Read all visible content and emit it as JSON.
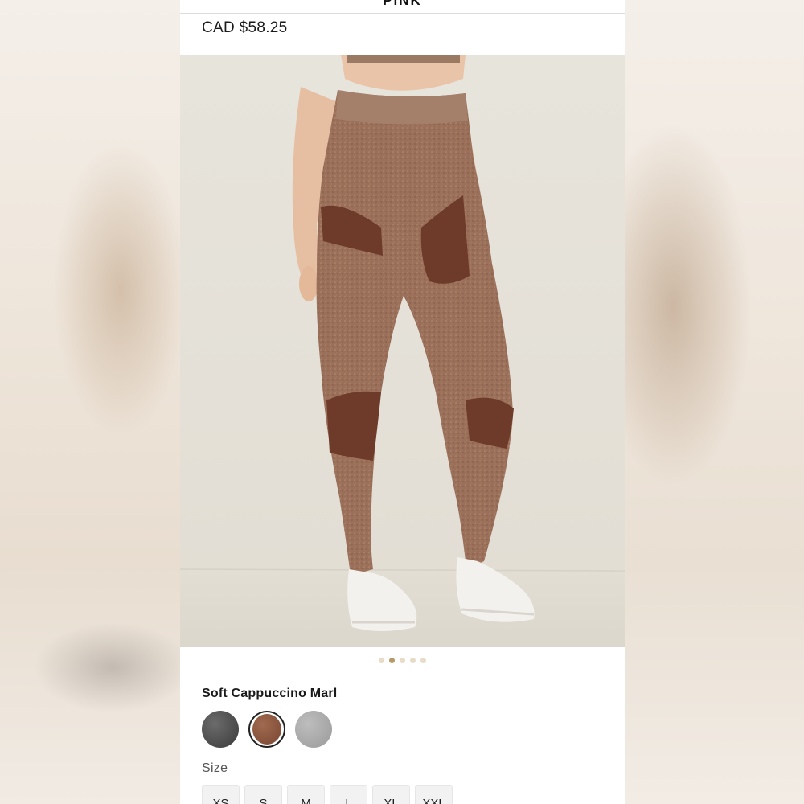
{
  "header": {
    "brand": "PINK"
  },
  "product": {
    "price": "CAD $58.25",
    "color_name": "Soft Cappuccino Marl",
    "carousel": {
      "total_images": 5,
      "active_index": 1
    },
    "swatches": [
      {
        "name": "charcoal-marl",
        "color": "#4a4a4a"
      },
      {
        "name": "soft-cappuccino-marl",
        "color": "#8a5a43",
        "selected": true
      },
      {
        "name": "heather-grey",
        "color": "#a9a9a9"
      }
    ]
  },
  "size": {
    "label": "Size",
    "options": [
      "XS",
      "S",
      "M",
      "L",
      "XL",
      "XXL"
    ]
  },
  "colors": {
    "legging": "#9a705a",
    "legging_panel": "#6e3a2a",
    "sneaker": "#f3f1ee"
  }
}
